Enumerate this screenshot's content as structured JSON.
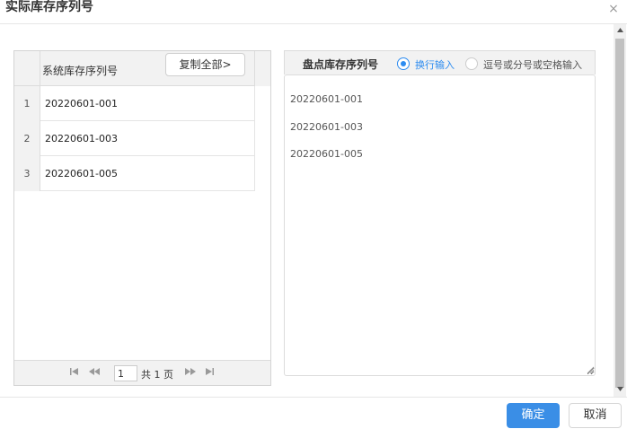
{
  "dialog": {
    "title": "实际库存序列号",
    "close_glyph": "×"
  },
  "grid": {
    "column_header": "系统库存序列号",
    "copy_all_label": "复制全部>",
    "rows": [
      {
        "num": "1",
        "serial": "20220601-001"
      },
      {
        "num": "2",
        "serial": "20220601-003"
      },
      {
        "num": "3",
        "serial": "20220601-005"
      }
    ],
    "pager": {
      "first_glyph": "⏮",
      "prev_glyph": "◀◀",
      "page_value": "1",
      "total_text": "共 1 页",
      "next_glyph": "▶▶",
      "last_glyph": "⏭"
    }
  },
  "count_panel": {
    "title": "盘点库存序列号",
    "radio_newline_label": "换行输入",
    "radio_comma_label": "逗号或分号或空格输入",
    "selected_mode": "换行输入",
    "accent_color": "#2d8cf0",
    "textarea_value": "20220601-001\n20220601-003\n20220601-005"
  },
  "footer": {
    "ok_label": "确定",
    "cancel_label": "取消",
    "ok_color": "#3a8ee6"
  }
}
